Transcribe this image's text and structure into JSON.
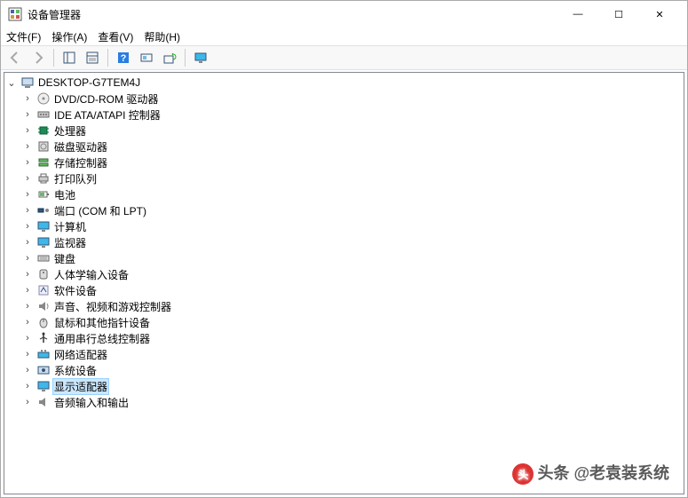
{
  "window": {
    "title": "设备管理器",
    "minimize": "—",
    "maximize": "☐",
    "close": "✕"
  },
  "menu": {
    "file": "文件(F)",
    "action": "操作(A)",
    "view": "查看(V)",
    "help": "帮助(H)"
  },
  "toolbar": {
    "back": "←",
    "forward": "→"
  },
  "tree": {
    "root": "DESKTOP-G7TEM4J",
    "items": [
      {
        "label": "DVD/CD-ROM 驱动器",
        "icon": "disc"
      },
      {
        "label": "IDE ATA/ATAPI 控制器",
        "icon": "ide"
      },
      {
        "label": "处理器",
        "icon": "cpu"
      },
      {
        "label": "磁盘驱动器",
        "icon": "hdd"
      },
      {
        "label": "存储控制器",
        "icon": "storage"
      },
      {
        "label": "打印队列",
        "icon": "printer"
      },
      {
        "label": "电池",
        "icon": "battery"
      },
      {
        "label": "端口 (COM 和 LPT)",
        "icon": "port"
      },
      {
        "label": "计算机",
        "icon": "computer"
      },
      {
        "label": "监视器",
        "icon": "monitor"
      },
      {
        "label": "键盘",
        "icon": "keyboard"
      },
      {
        "label": "人体学输入设备",
        "icon": "hid"
      },
      {
        "label": "软件设备",
        "icon": "software"
      },
      {
        "label": "声音、视频和游戏控制器",
        "icon": "sound"
      },
      {
        "label": "鼠标和其他指针设备",
        "icon": "mouse"
      },
      {
        "label": "通用串行总线控制器",
        "icon": "usb"
      },
      {
        "label": "网络适配器",
        "icon": "network"
      },
      {
        "label": "系统设备",
        "icon": "system"
      },
      {
        "label": "显示适配器",
        "icon": "display",
        "selected": true
      },
      {
        "label": "音频输入和输出",
        "icon": "audio"
      }
    ]
  },
  "watermark": "头条 @老袁装系统"
}
